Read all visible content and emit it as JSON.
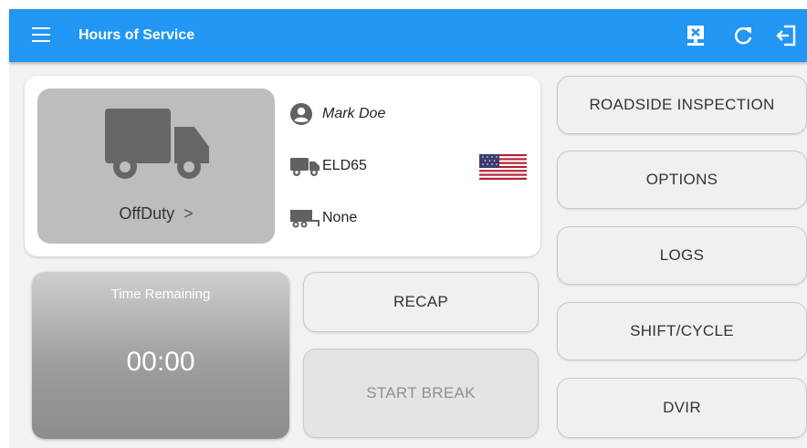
{
  "appbar": {
    "title": "Hours of Service",
    "color": "#2196f3",
    "icons": [
      "menu-icon",
      "eld-monitor-icon",
      "refresh-icon",
      "logout-icon"
    ]
  },
  "driver_card": {
    "status_label": "OffDuty",
    "status_chevron": ">",
    "driver_name": "Mark Doe",
    "vehicle": "ELD65",
    "trailer": "None",
    "country_flag": "us-flag-icon"
  },
  "time_remaining": {
    "label": "Time Remaining",
    "value": "00:00"
  },
  "buttons": {
    "recap": "RECAP",
    "start_break": "START BREAK",
    "roadside_inspection": "ROADSIDE INSPECTION",
    "options": "OPTIONS",
    "logs": "LOGS",
    "shift_cycle": "SHIFT/CYCLE",
    "dvir": "DVIR"
  }
}
